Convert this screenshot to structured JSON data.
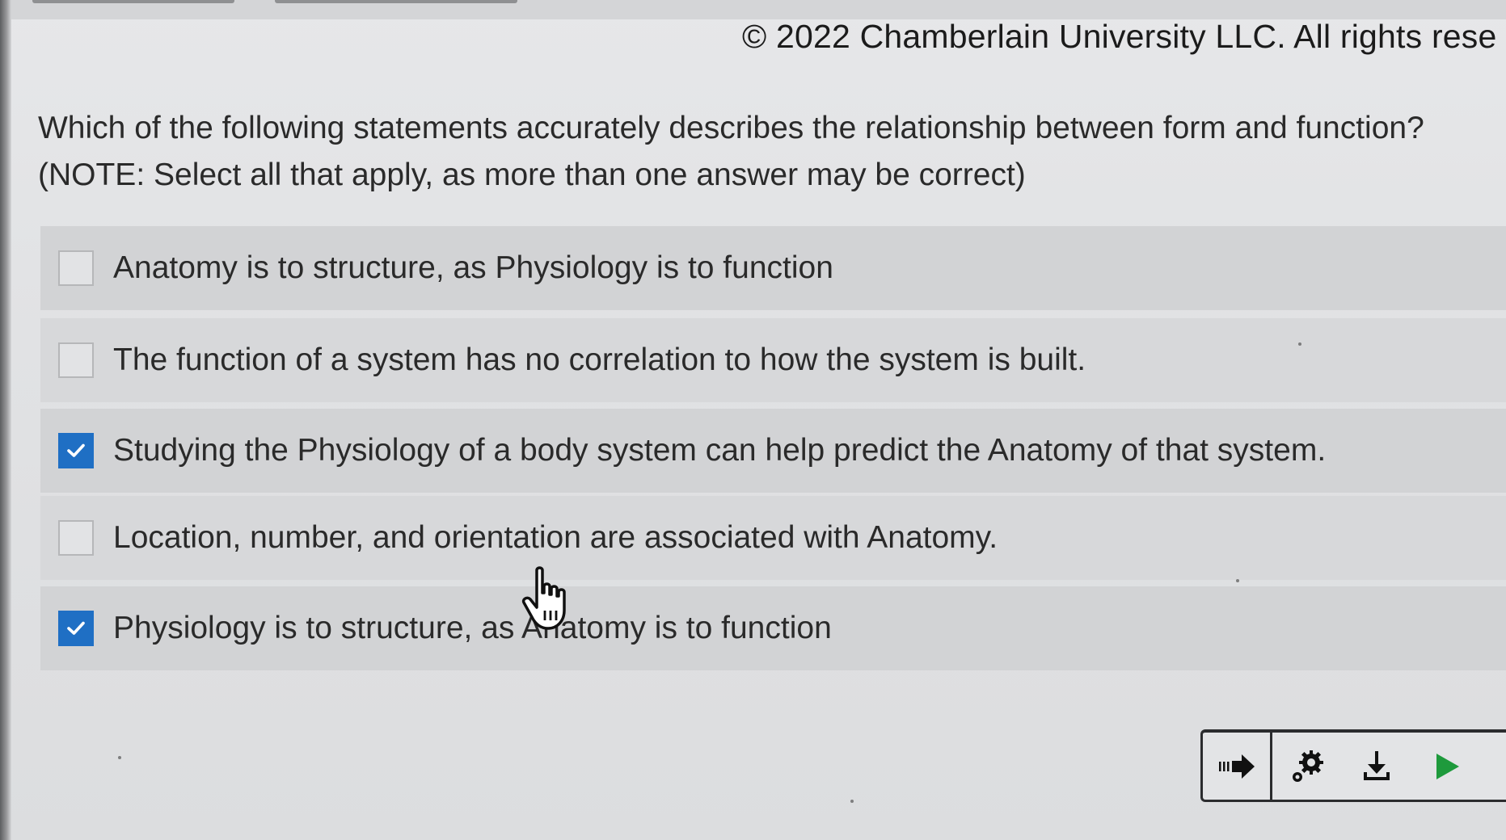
{
  "copyright": "© 2022 Chamberlain University LLC. All rights rese",
  "question": {
    "line1": "Which of the following statements accurately describes the relationship between form and function?",
    "line2": "(NOTE: Select all that apply, as more than one answer may be correct)"
  },
  "options": [
    {
      "label": "Anatomy is to structure, as Physiology is to function",
      "checked": false
    },
    {
      "label": "The function of a system has no correlation to how the system is built.",
      "checked": false
    },
    {
      "label": "Studying the Physiology of a body system can help predict the Anatomy of that system.",
      "checked": true
    },
    {
      "label": "Location, number, and orientation are associated with Anatomy.",
      "checked": false
    },
    {
      "label": "Physiology is to structure, as Anatomy is to function",
      "checked": true
    }
  ],
  "colors": {
    "checkbox_checked": "#1f6fc4",
    "play_icon": "#1e9a3c",
    "text": "#2a2a2a"
  },
  "toolbar": {
    "icons": [
      "skip-forward-arrow-icon",
      "settings-gears-icon",
      "download-icon",
      "play-icon"
    ]
  },
  "cursor": "hand-pointer-cursor"
}
